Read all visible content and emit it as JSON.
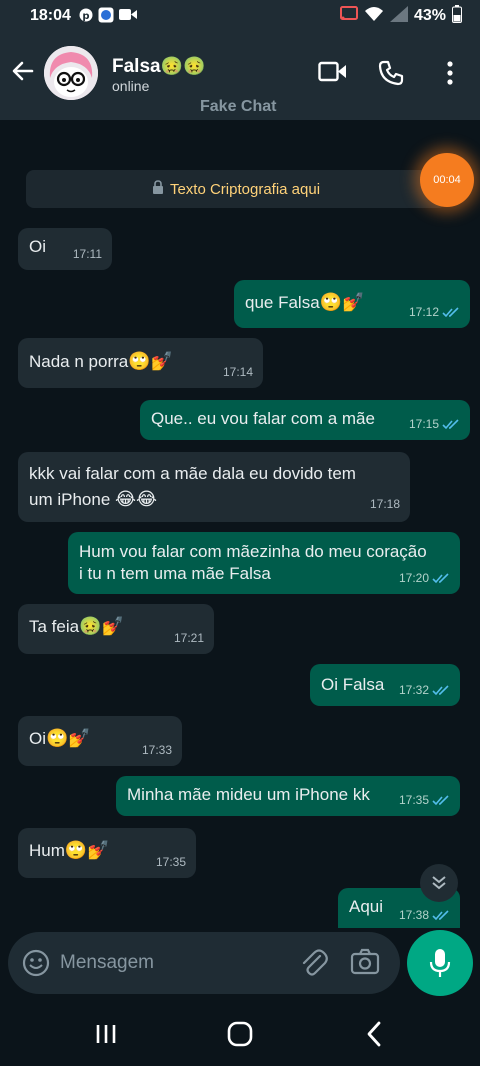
{
  "status_bar": {
    "time": "18:04",
    "battery": "43%",
    "icons": [
      "pinterest-icon",
      "messenger-icon",
      "video-camera-icon",
      "cast-icon",
      "wifi-icon",
      "signal-icon",
      "battery-icon"
    ]
  },
  "header": {
    "name": "Falsa",
    "name_emoji": "🤢🤢",
    "status": "online",
    "watermark": "Fake Chat"
  },
  "chat": {
    "encryption_notice": "Texto Criptografia aqui",
    "recording_badge": "00:04",
    "messages": [
      {
        "dir": "in",
        "text": "Oi",
        "emoji": "",
        "time": "17:11"
      },
      {
        "dir": "out",
        "text": "que Falsa",
        "emoji": "🙄💅",
        "time": "17:12"
      },
      {
        "dir": "in",
        "text": "Nada n porra",
        "emoji": "🙄💅",
        "time": "17:14"
      },
      {
        "dir": "out",
        "text": "Que.. eu vou falar com a mãe",
        "emoji": "",
        "time": "17:15"
      },
      {
        "dir": "in",
        "text": "kkk vai falar com a mãe dala eu dovido tem",
        "text2": "um iPhone",
        "emoji": "😂😂",
        "time": "17:18"
      },
      {
        "dir": "out",
        "text": "Hum vou falar com mãezinha do meu coração",
        "text2": "i tu n tem uma mãe Falsa",
        "emoji": "",
        "time": "17:20"
      },
      {
        "dir": "in",
        "text": "Ta feia",
        "emoji": "🤢💅",
        "time": "17:21"
      },
      {
        "dir": "out",
        "text": "Oi Falsa",
        "emoji": "",
        "time": "17:32"
      },
      {
        "dir": "in",
        "text": "Oi",
        "emoji": "🙄💅",
        "time": "17:33"
      },
      {
        "dir": "out",
        "text": "Minha mãe mideu um iPhone kk",
        "emoji": "",
        "time": "17:35"
      },
      {
        "dir": "in",
        "text": "Hum",
        "emoji": "🙄💅",
        "time": "17:35"
      },
      {
        "dir": "out",
        "text": "Aqui",
        "emoji": "",
        "time": "17:38"
      }
    ]
  },
  "composer": {
    "placeholder": "Mensagem"
  },
  "colors": {
    "background": "#0b141a",
    "incoming": "#202c33",
    "outgoing": "#005c4b",
    "accent": "#00a884",
    "read_ticks": "#53bdeb"
  }
}
